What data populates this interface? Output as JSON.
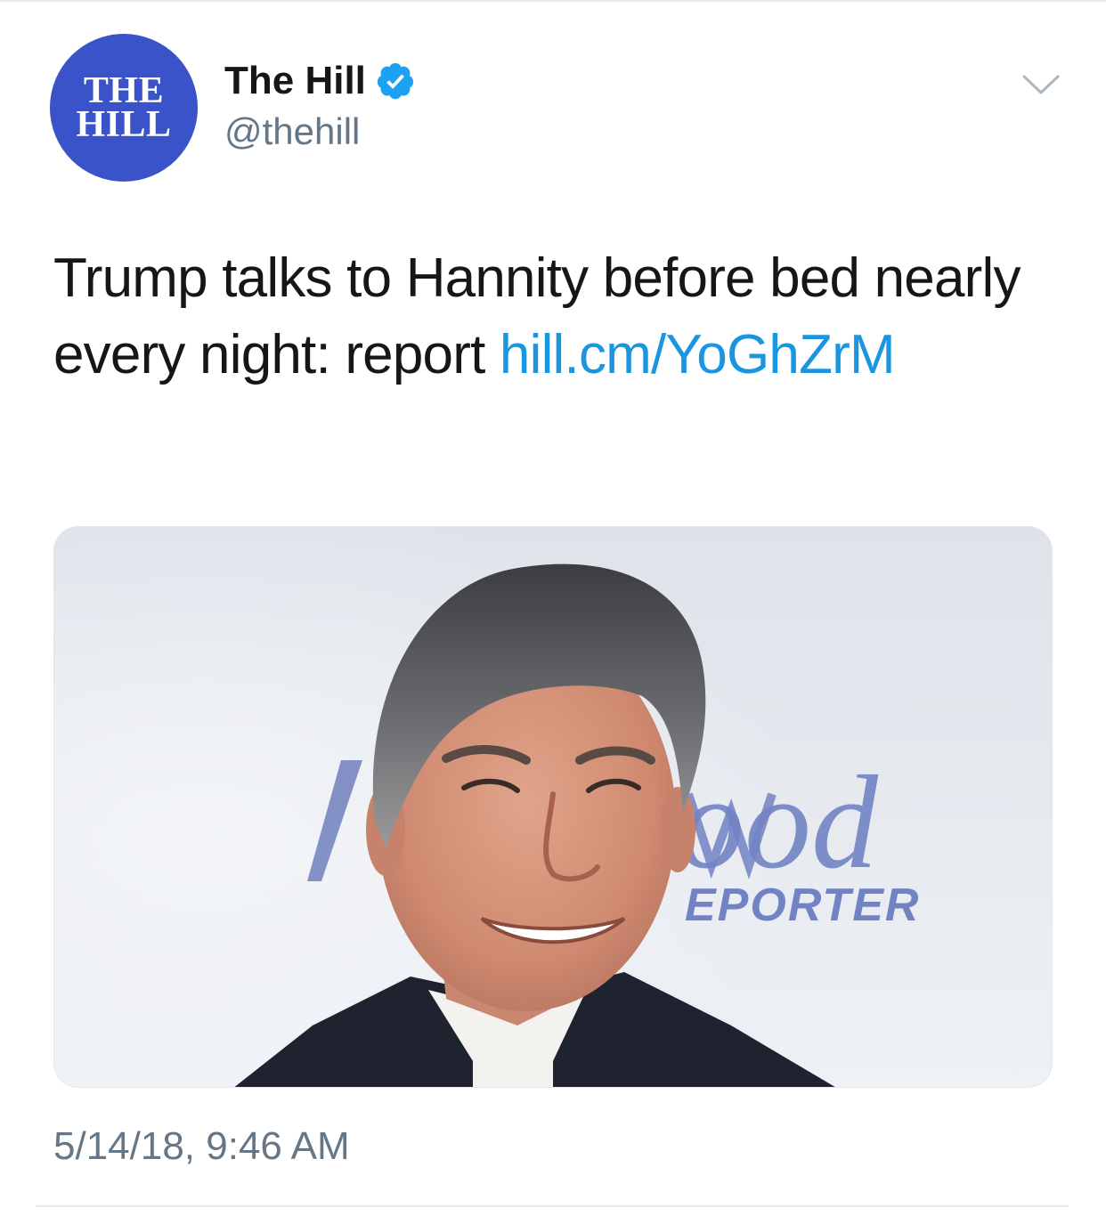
{
  "account": {
    "avatar_text": [
      "THE",
      "HILL"
    ],
    "display_name": "The Hill",
    "handle": "@thehill",
    "verified": true,
    "verified_icon": "verified-badge-icon",
    "avatar_color": "#3a53c9"
  },
  "menu": {
    "icon": "chevron-down-icon"
  },
  "tweet": {
    "text": "Trump talks to Hannity before bed nearly every night: report ",
    "link_text": "hill.cm/YoGhZrM",
    "link_color": "#1b95e0"
  },
  "media": {
    "backdrop_text_1": "ood",
    "backdrop_text_2": "EPORTER"
  },
  "timestamp": "5/14/18, 9:46 AM"
}
